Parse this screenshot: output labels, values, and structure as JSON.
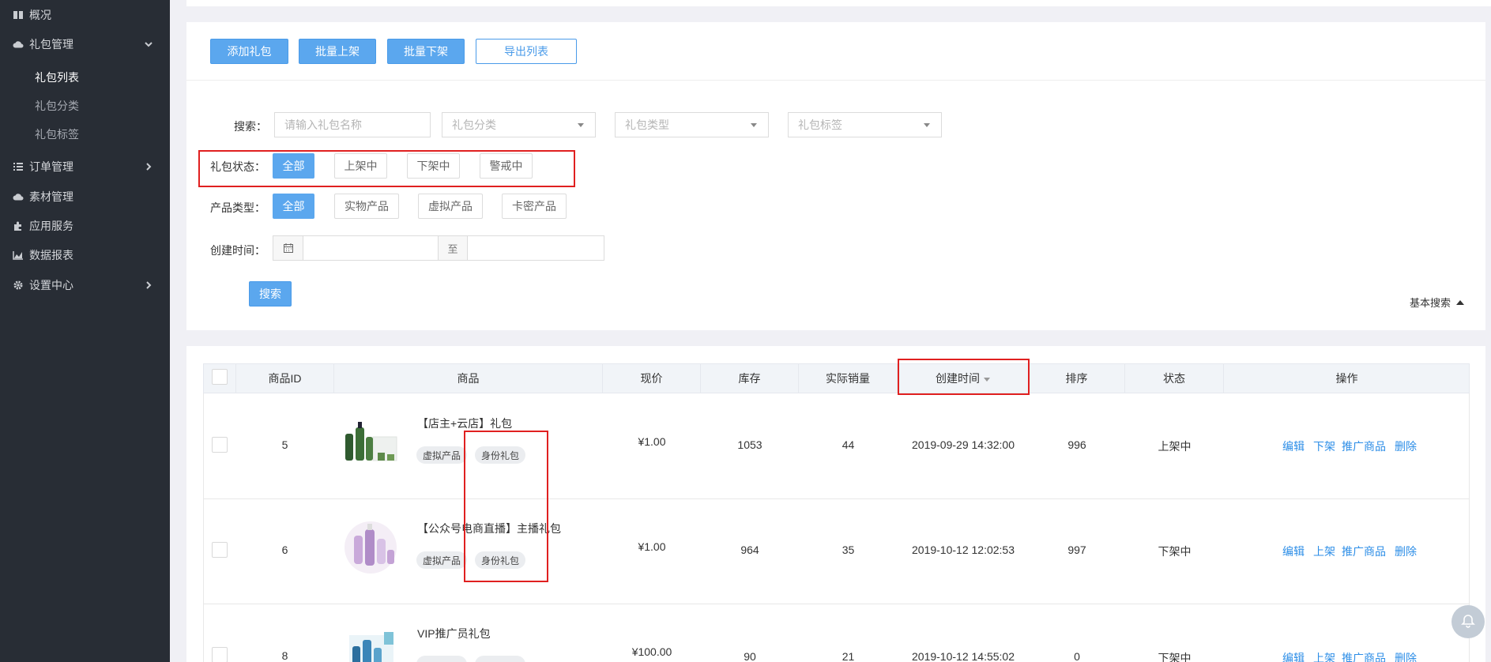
{
  "sidebar": {
    "items": [
      {
        "label": "概况",
        "icon": "book-icon"
      },
      {
        "label": "礼包管理",
        "icon": "cloud-icon"
      },
      {
        "label": "订单管理",
        "icon": "list-icon"
      },
      {
        "label": "素材管理",
        "icon": "cloud-icon"
      },
      {
        "label": "应用服务",
        "icon": "puzzle-icon"
      },
      {
        "label": "数据报表",
        "icon": "area-chart-icon"
      },
      {
        "label": "设置中心",
        "icon": "gear-icon"
      }
    ],
    "sub_items": [
      {
        "label": "礼包列表",
        "active": true
      },
      {
        "label": "礼包分类",
        "active": false
      },
      {
        "label": "礼包标签",
        "active": false
      }
    ]
  },
  "toolbar": {
    "add": "添加礼包",
    "batch_on": "批量上架",
    "batch_off": "批量下架",
    "export": "导出列表"
  },
  "filters": {
    "search_label": "搜索：",
    "search_placeholder": "请输入礼包名称",
    "category_placeholder": "礼包分类",
    "type_placeholder": "礼包类型",
    "tag_placeholder": "礼包标签",
    "status_label": "礼包状态：",
    "status_options": [
      "全部",
      "上架中",
      "下架中",
      "警戒中"
    ],
    "product_label": "产品类型：",
    "product_options": [
      "全部",
      "实物产品",
      "虚拟产品",
      "卡密产品"
    ],
    "time_label": "创建时间：",
    "to": "至",
    "search_button": "搜索",
    "basic_search": "基本搜索"
  },
  "table": {
    "headers": [
      "商品ID",
      "商品",
      "现价",
      "库存",
      "实际销量",
      "创建时间",
      "排序",
      "状态",
      "操作"
    ],
    "rows": [
      {
        "id": "5",
        "name": "【店主+云店】礼包",
        "tags": [
          "虚拟产品",
          "身份礼包"
        ],
        "price": "¥1.00",
        "stock": "1053",
        "sales": "44",
        "created": "2019-09-29 14:32:00",
        "sort": "996",
        "status": "上架中",
        "ops": [
          "编辑",
          "下架",
          "推广商品",
          "删除"
        ]
      },
      {
        "id": "6",
        "name": "【公众号电商直播】主播礼包",
        "tags": [
          "虚拟产品",
          "身份礼包"
        ],
        "price": "¥1.00",
        "stock": "964",
        "sales": "35",
        "created": "2019-10-12 12:02:53",
        "sort": "997",
        "status": "下架中",
        "ops": [
          "编辑",
          "上架",
          "推广商品",
          "删除"
        ]
      },
      {
        "id": "8",
        "name": "VIP推广员礼包",
        "tags": [],
        "price": "¥100.00",
        "stock": "90",
        "sales": "21",
        "created": "2019-10-12 14:55:02",
        "sort": "0",
        "status": "下架中",
        "ops": [
          "编辑",
          "上架",
          "推广商品",
          "删除"
        ]
      }
    ]
  },
  "colors": {
    "primary": "#5ba7ee",
    "sidebar": "#282d35",
    "link": "#2d8ee7",
    "highlight": "#e02020"
  }
}
